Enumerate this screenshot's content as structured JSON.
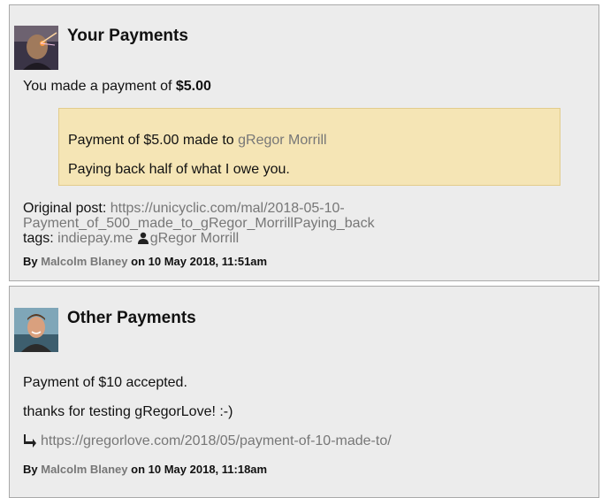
{
  "cards": [
    {
      "title": "Your Payments",
      "intro_prefix": "You made a payment of",
      "intro_amount": "$5.00",
      "quote": {
        "line1_prefix": "Payment of $5.00 made to",
        "line1_link": "gRegor Morrill",
        "line2": "Paying back half of what I owe you."
      },
      "original_post_label": "Original post:",
      "original_post_url_line1": "https://unicyclic.com/mal/2018-05-10-",
      "original_post_url_line2": "Payment_of_500_made_to_gRegor_MorrillPaying_back",
      "tags_label": "tags:",
      "tag1": "indiepay.me",
      "tag2": "gRegor Morrill",
      "by_label": "By",
      "author": "Malcolm Blaney",
      "on_label": "on",
      "date": "10 May 2018, 11:51am"
    },
    {
      "title": "Other Payments",
      "line1": "Payment of $10 accepted.",
      "line2": "thanks for testing gRegorLove! :-)",
      "reply_url": "https://gregorlove.com/2018/05/payment-of-10-made-to/",
      "by_label": "By",
      "author": "Malcolm Blaney",
      "on_label": "on",
      "date": "10 May 2018, 11:18am"
    }
  ],
  "icons": [
    "person-icon",
    "reply-icon"
  ]
}
